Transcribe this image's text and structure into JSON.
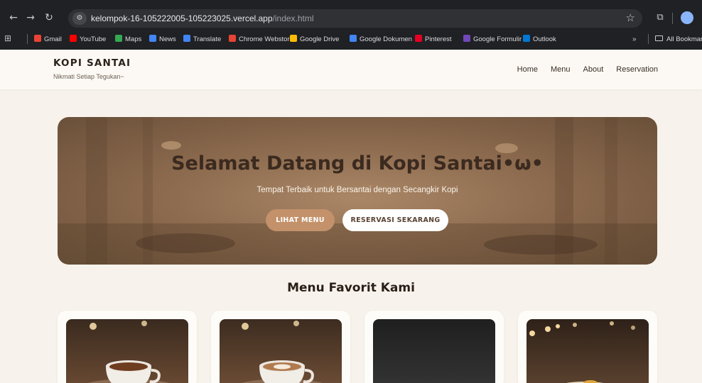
{
  "browser": {
    "url_host": "kelompok-16-105222005-105223025.vercel.app",
    "url_path": "/index.html",
    "bookmarks": [
      {
        "label": "Gmail",
        "color": "#ea4335"
      },
      {
        "label": "YouTube",
        "color": "#ff0000"
      },
      {
        "label": "Maps",
        "color": "#34a853"
      },
      {
        "label": "News",
        "color": "#4285f4"
      },
      {
        "label": "Translate",
        "color": "#4285f4"
      },
      {
        "label": "Chrome Webstore",
        "color": "#e94335"
      },
      {
        "label": "Google Drive",
        "color": "#fbbc04"
      },
      {
        "label": "Google Dokumen",
        "color": "#4285f4"
      },
      {
        "label": "Pinterest",
        "color": "#e60023"
      },
      {
        "label": "Google Formulir",
        "color": "#7248b9"
      },
      {
        "label": "Outlook",
        "color": "#0078d4"
      }
    ],
    "more_label": "»",
    "all_bookmarks_label": "All Bookmarks"
  },
  "site": {
    "logo": "KOPI SANTAI",
    "tagline": "Nikmati Setiap Tegukan~",
    "nav": [
      "Home",
      "Menu",
      "About",
      "Reservation"
    ]
  },
  "hero": {
    "title": "Selamat Datang di Kopi Santai•ω•",
    "subtitle": "Tempat Terbaik untuk Bersantai dengan Secangkir Kopi",
    "btn_menu": "LIHAT MENU",
    "btn_reserve": "RESERVASI SEKARANG"
  },
  "menu": {
    "title": "Menu Favorit Kami"
  },
  "colors": {
    "accent": "#c3916a",
    "background": "#f7f3ec",
    "dark_text": "#2a1f18"
  }
}
